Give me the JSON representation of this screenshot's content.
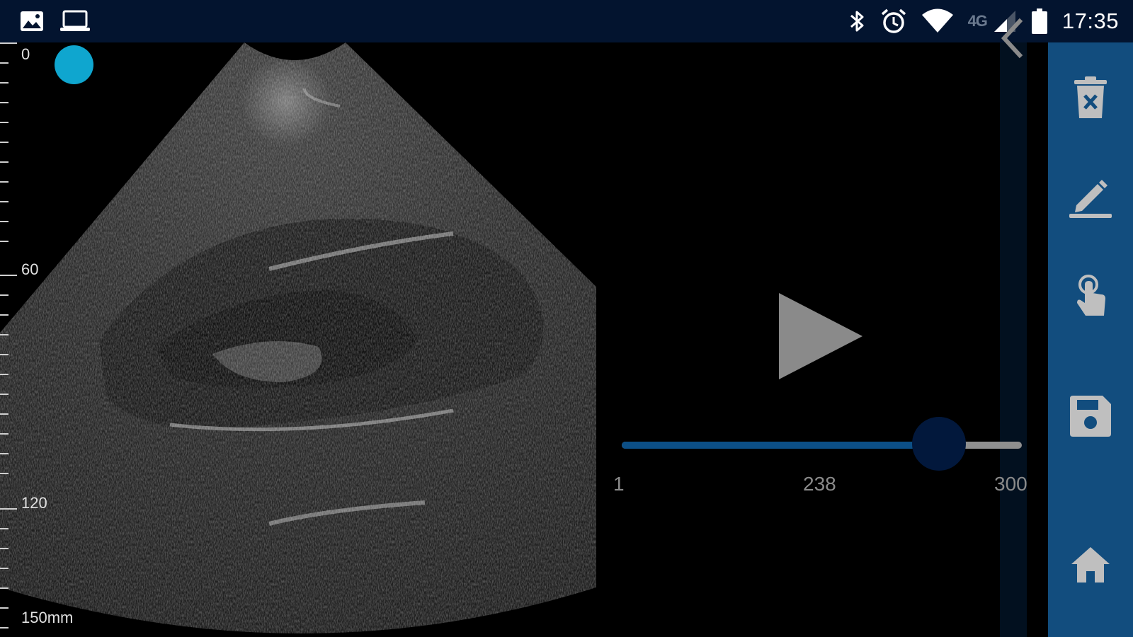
{
  "status_bar": {
    "icons_left": [
      "image-icon",
      "laptop-icon"
    ],
    "icons_right": [
      "bluetooth-icon",
      "alarm-icon",
      "wifi-icon",
      "network-4g-icon",
      "signal-icon",
      "battery-icon"
    ],
    "network_label": "4G",
    "time": "17:35"
  },
  "scan": {
    "depth_labels": {
      "top": "0",
      "mid1": "60",
      "mid2": "120",
      "bottom": "150mm"
    },
    "focus_color": "#0fa6cf"
  },
  "playback": {
    "min_frame": "1",
    "current_frame": "238",
    "max_frame": "300",
    "progress": 0.7926
  },
  "toolbar": {
    "items": [
      "delete-icon",
      "annotate-icon",
      "touch-icon",
      "save-icon",
      "home-icon"
    ],
    "background": "#124d7e"
  },
  "colors": {
    "status_bar": "#03142f",
    "slider_fill": "#0c4f86",
    "slider_thumb": "#02183c",
    "accent": "#0fa6cf"
  }
}
